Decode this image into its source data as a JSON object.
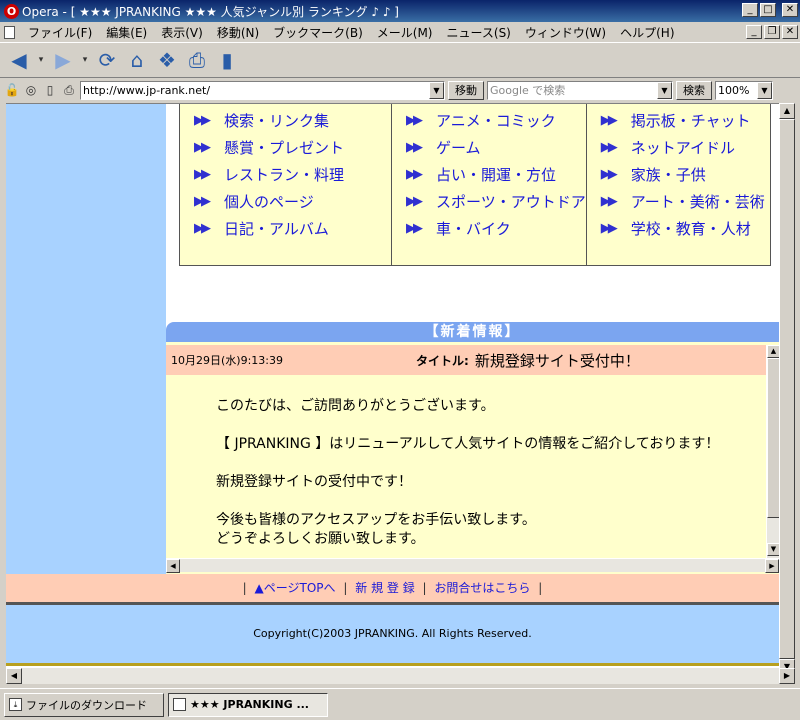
{
  "window": {
    "app_name": "Opera",
    "title": "Opera - [ ★★★ JPRANKING ★★★ 人気ジャンル別 ランキング ♪ ♪ ]"
  },
  "menu": {
    "items": [
      "ファイル(F)",
      "編集(E)",
      "表示(V)",
      "移動(N)",
      "ブックマーク(B)",
      "メール(M)",
      "ニュース(S)",
      "ウィンドウ(W)",
      "ヘルプ(H)"
    ]
  },
  "address": {
    "url": "http://www.jp-rank.net/",
    "go_label": "移動",
    "search_placeholder": "Google で検索",
    "search_label": "検索",
    "zoom": "100%"
  },
  "genres": {
    "col1": [
      "検索・リンク集",
      "懸賞・プレゼント",
      "レストラン・料理",
      "個人のページ",
      "日記・アルバム"
    ],
    "col2": [
      "アニメ・コミック",
      "ゲーム",
      "占い・開運・方位",
      "スポーツ・アウトドア",
      "車・バイク"
    ],
    "col3": [
      "掲示板・チャット",
      "ネットアイドル",
      "家族・子供",
      "アート・美術・芸術",
      "学校・教育・人材"
    ]
  },
  "news": {
    "header": "【新着情報】",
    "date": "10月29日(水)9:13:39",
    "title_label": "タイトル:",
    "title": "新規登録サイト受付中！",
    "body": [
      "このたびは、ご訪問ありがとうございます。",
      "【 JPRANKING 】はリニューアルして人気サイトの情報をご紹介しております！",
      "新規登録サイトの受付中です！",
      "今後も皆様のアクセスアップをお手伝い致します。",
      "どうぞよろしくお願い致します。"
    ]
  },
  "footer": {
    "link_top": "▲ページTOPへ",
    "link_register": "新 規 登 録",
    "link_contact": "お問合せはこちら",
    "separator": "|",
    "copyright": "Copyright(C)2003 JPRANKING. All Rights Reserved."
  },
  "taskbar": {
    "download": "ファイルのダウンロード",
    "page": "★★★ JPRANKING ..."
  }
}
